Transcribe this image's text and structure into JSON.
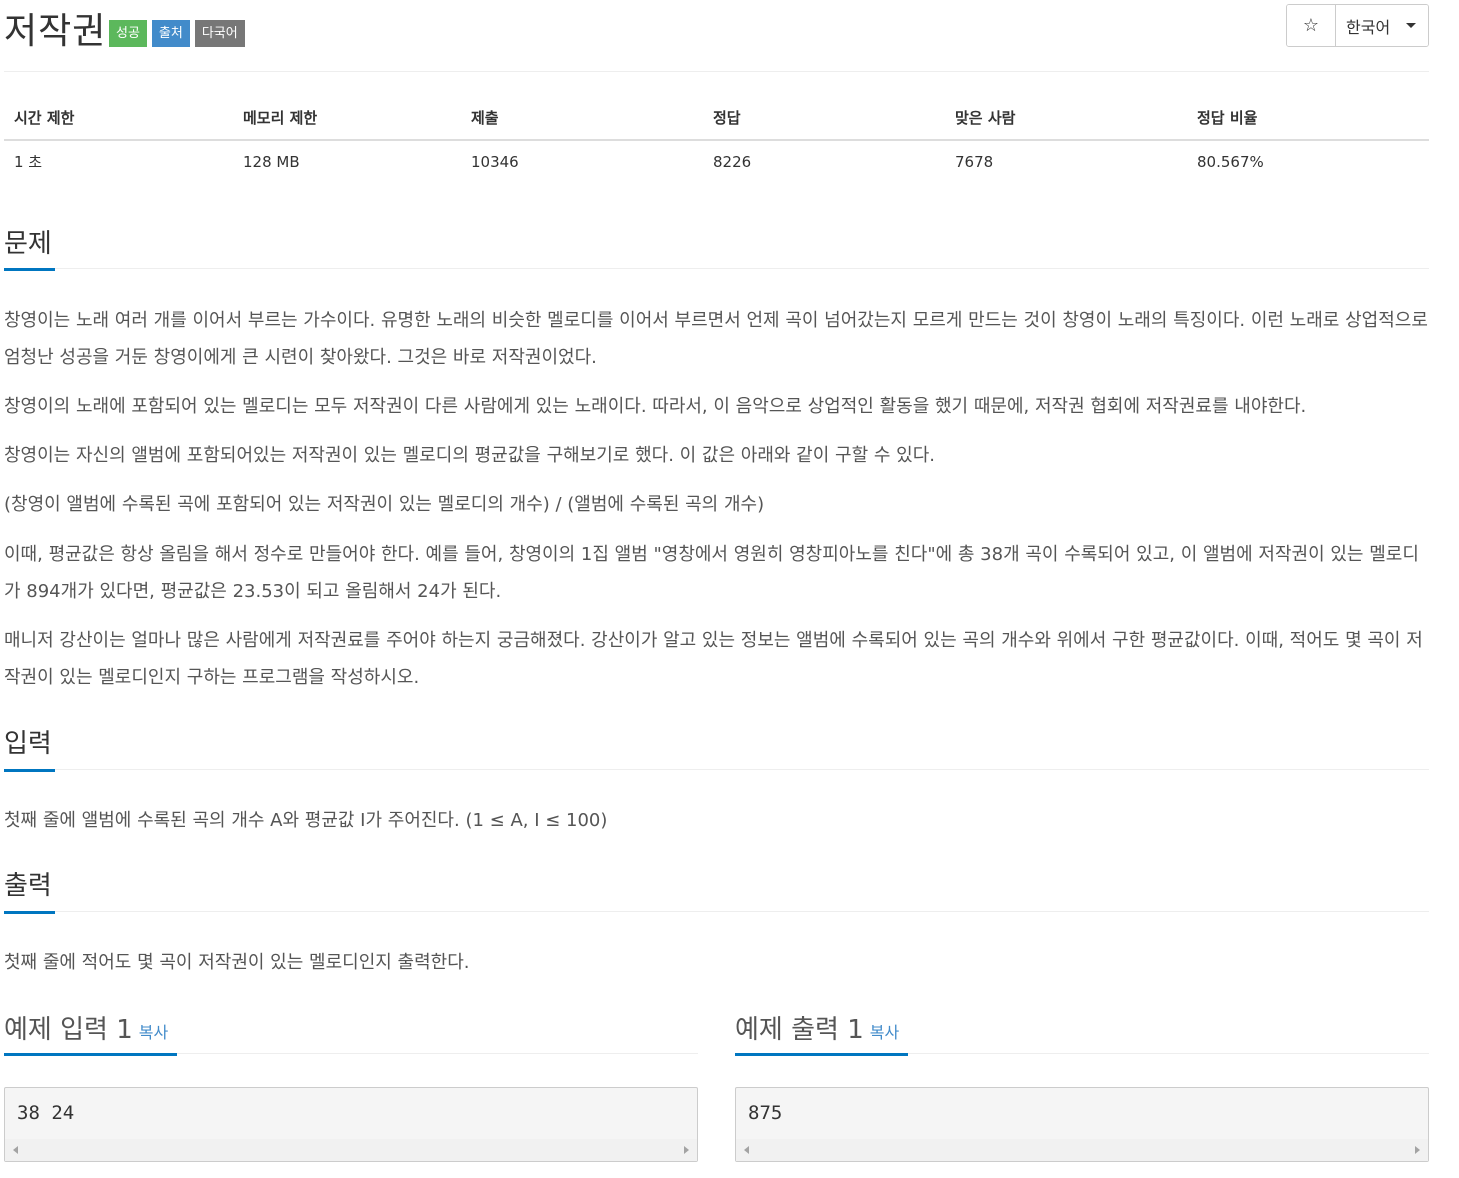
{
  "header": {
    "title": "저작권",
    "labels": [
      "성공",
      "출처",
      "다국어"
    ],
    "star_icon": "☆",
    "language": "한국어"
  },
  "info_table": {
    "headers": [
      "시간 제한",
      "메모리 제한",
      "제출",
      "정답",
      "맞은 사람",
      "정답 비율"
    ],
    "values": [
      "1 초",
      "128 MB",
      "10346",
      "8226",
      "7678",
      "80.567%"
    ]
  },
  "problem": {
    "heading": "문제",
    "paragraphs": [
      "창영이는 노래 여러 개를 이어서 부르는 가수이다. 유명한 노래의 비슷한 멜로디를 이어서 부르면서 언제 곡이 넘어갔는지 모르게 만드는 것이 창영이 노래의 특징이다. 이런 노래로 상업적으로 엄청난 성공을 거둔 창영이에게 큰 시련이 찾아왔다. 그것은 바로 저작권이었다.",
      "창영이의 노래에 포함되어 있는 멜로디는 모두 저작권이 다른 사람에게 있는 노래이다. 따라서, 이 음악으로 상업적인 활동을 했기 때문에, 저작권 협회에 저작권료를 내야한다.",
      "창영이는 자신의 앨범에 포함되어있는 저작권이 있는 멜로디의 평균값을 구해보기로 했다. 이 값은 아래와 같이 구할 수 있다.",
      "(창영이 앨범에 수록된 곡에 포함되어 있는 저작권이 있는 멜로디의 개수) / (앨범에 수록된 곡의 개수)",
      "이때, 평균값은 항상 올림을 해서 정수로 만들어야 한다. 예를 들어, 창영이의 1집 앨범 \"영창에서 영원히 영창피아노를 친다\"에 총 38개 곡이 수록되어 있고, 이 앨범에 저작권이 있는 멜로디가 894개가 있다면, 평균값은 23.53이 되고 올림해서 24가 된다.",
      "매니저 강산이는 얼마나 많은 사람에게 저작권료를 주어야 하는지 궁금해졌다. 강산이가 알고 있는 정보는 앨범에 수록되어 있는 곡의 개수와 위에서 구한 평균값이다. 이때, 적어도 몇 곡이 저작권이 있는 멜로디인지 구하는 프로그램을 작성하시오."
    ]
  },
  "input": {
    "heading": "입력",
    "text": "첫째 줄에 앨범에 수록된 곡의 개수 A와 평균값 I가 주어진다. (1 ≤ A, I ≤ 100)"
  },
  "output": {
    "heading": "출력",
    "text": "첫째 줄에 적어도 몇 곡이 저작권이 있는 멜로디인지 출력한다."
  },
  "samples": {
    "input_title": "예제 입력 1",
    "output_title": "예제 출력 1",
    "copy_label": "복사",
    "input_value": "38 24",
    "output_value": "875"
  }
}
